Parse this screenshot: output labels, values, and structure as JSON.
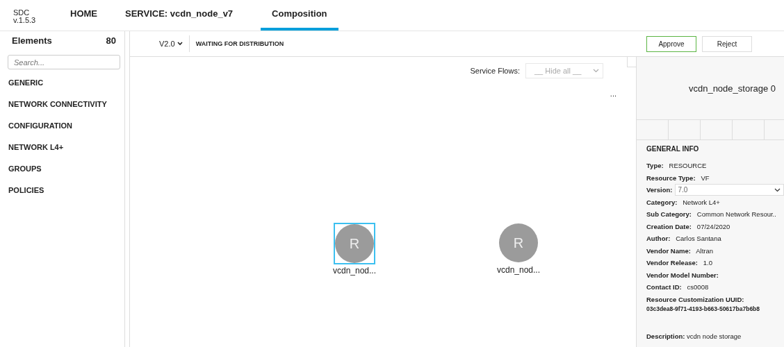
{
  "app": {
    "name": "SDC",
    "version": "v.1.5.3"
  },
  "tabs": [
    {
      "label": "HOME",
      "selected": false
    },
    {
      "label": "SERVICE: vcdn_node_v7",
      "selected": false
    },
    {
      "label": "Composition",
      "selected": true
    }
  ],
  "sidebar": {
    "title": "Elements",
    "count": "80",
    "search": {
      "placeholder": "Search..."
    },
    "items": [
      "GENERIC",
      "NETWORK CONNECTIVITY",
      "CONFIGURATION",
      "NETWORK L4+",
      "GROUPS",
      "POLICIES"
    ]
  },
  "toolbar": {
    "version": "V2.0",
    "status": "WAITING FOR DISTRIBUTION",
    "buttons": [
      {
        "label": "Approve",
        "kind": "primary"
      },
      {
        "label": "Reject",
        "kind": "secondary"
      }
    ]
  },
  "canvas": {
    "service_flows_label": "Service Flows:",
    "service_flows": {
      "placeholder": "__ Hide all __"
    },
    "more": "...",
    "nodes": [
      {
        "letter": "R",
        "label": "vcdn_nod...",
        "selected": true
      },
      {
        "letter": "R",
        "label": "vcdn_nod...",
        "selected": false
      }
    ]
  },
  "details": {
    "title": "vcdn_node_storage 0",
    "section": "GENERAL INFO",
    "fields": [
      {
        "label": "Type:",
        "value": "RESOURCE",
        "kind": "text"
      },
      {
        "label": "Resource Type:",
        "value": "VF",
        "kind": "text"
      },
      {
        "label": "Version:",
        "value": "7.0",
        "kind": "select"
      },
      {
        "label": "Category:",
        "value": "Network L4+",
        "kind": "text"
      },
      {
        "label": "Sub Category:",
        "value": "Common Network Resour..",
        "kind": "text"
      },
      {
        "label": "Creation Date:",
        "value": "07/24/2020",
        "kind": "text"
      },
      {
        "label": "Author:",
        "value": "Carlos Santana",
        "kind": "text"
      },
      {
        "label": "Vendor Name:",
        "value": "Altran",
        "kind": "text"
      },
      {
        "label": "Vendor Release:",
        "value": "1.0",
        "kind": "text"
      },
      {
        "label": "Vendor Model Number:",
        "kind": "text"
      },
      {
        "label": "Contact ID:",
        "value": "cs0008",
        "kind": "text"
      },
      {
        "label": "Resource Customization UUID:",
        "value": "03c3dea8-9f71-4193-b663-50617ba7b6b8",
        "kind": "block"
      }
    ],
    "description_label": "Description:",
    "description": "vcdn node storage"
  }
}
